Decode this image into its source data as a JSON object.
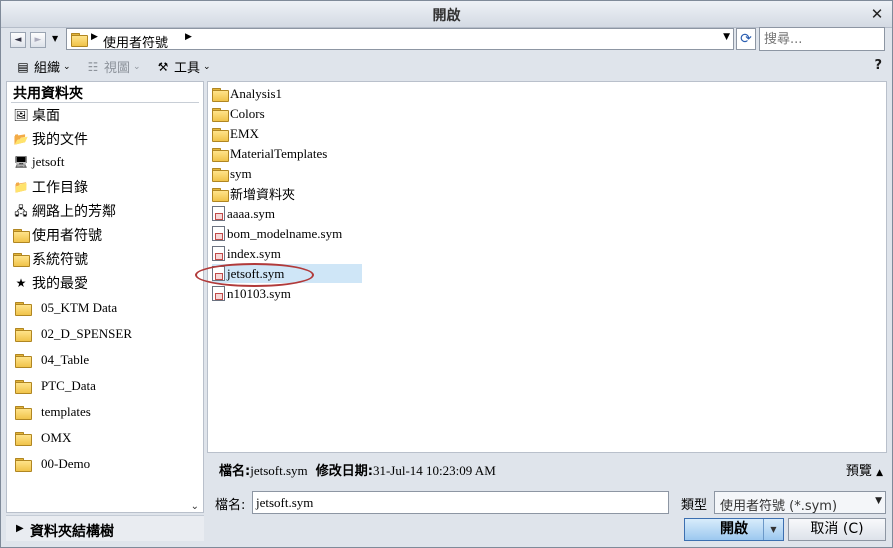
{
  "window": {
    "title": "開啟",
    "close_glyph": "✕"
  },
  "addressbar": {
    "crumb": "使用者符號",
    "search_placeholder": "搜尋...",
    "back_glyph": "◄",
    "forward_glyph": "►",
    "dropdown_glyph": "▼",
    "refresh_glyph": "⟳"
  },
  "toolbar": {
    "organize": "組織",
    "views": "視圖",
    "tools": "工具",
    "help": "?"
  },
  "sidebar": {
    "header": "共用資料夾",
    "items": [
      {
        "label": "桌面",
        "icon": "desktop-icon"
      },
      {
        "label": "我的文件",
        "icon": "documents-icon"
      },
      {
        "label": "jetsoft",
        "icon": "computer-icon"
      },
      {
        "label": "工作目錄",
        "icon": "working-directory-icon"
      },
      {
        "label": "網路上的芳鄰",
        "icon": "network-icon"
      },
      {
        "label": "使用者符號",
        "icon": "folder-icon"
      },
      {
        "label": "系統符號",
        "icon": "folder-icon"
      },
      {
        "label": "我的最愛",
        "icon": "favorites-icon"
      }
    ],
    "folders": [
      "05_KTM Data",
      "02_D_SPENSER",
      "04_Table",
      "PTC_Data",
      "templates",
      "OMX",
      "00-Demo"
    ],
    "tree_label": "資料夾結構樹"
  },
  "files": [
    {
      "name": "Analysis1",
      "type": "folder"
    },
    {
      "name": "Colors",
      "type": "folder"
    },
    {
      "name": "EMX",
      "type": "folder"
    },
    {
      "name": "MaterialTemplates",
      "type": "folder"
    },
    {
      "name": "sym",
      "type": "folder"
    },
    {
      "name": "新增資料夾",
      "type": "folder"
    },
    {
      "name": "aaaa.sym",
      "type": "file"
    },
    {
      "name": "bom_modelname.sym",
      "type": "file"
    },
    {
      "name": "index.sym",
      "type": "file"
    },
    {
      "name": "jetsoft.sym",
      "type": "file",
      "selected": true
    },
    {
      "name": "n10103.sym",
      "type": "file"
    }
  ],
  "details": {
    "name_label": "檔名:",
    "name_value": "jetsoft.sym",
    "modified_label": "修改日期:",
    "modified_value": "31-Jul-14 10:23:09 AM",
    "preview_label": "預覽"
  },
  "footer": {
    "filename_label": "檔名:",
    "filename_value": "jetsoft.sym",
    "type_label": "類型",
    "type_value": "使用者符號 (*.sym)",
    "open_label": "開啟",
    "cancel_label": "取消 (C)"
  },
  "colors": {
    "selection": "#cfe6f7",
    "highlight_ring": "#b13a3a",
    "open_button": "#9cc8ef"
  }
}
